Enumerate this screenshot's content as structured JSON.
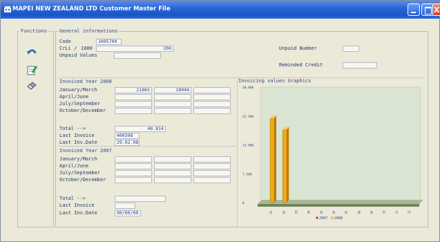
{
  "window": {
    "title": "MAPEI NEW ZEALAND LTD   Customer Master File",
    "close_glyph": "X"
  },
  "functions": {
    "legend": "Functions",
    "icons": [
      "undo-icon",
      "edit-icon",
      "eraser-icon"
    ]
  },
  "general": {
    "legend": "General informations",
    "code_label": "Code",
    "code_value": "1005700",
    "crli_label": "CrLi /",
    "crli_value1": "1000",
    "crli_value2": "200",
    "unpaid_values_label": "Unpaid Values",
    "unpaid_values_value": "",
    "unpaid_number_label": "Unpaid Number",
    "unpaid_number_value": "",
    "reminded_credit_label": "Reminded Credit",
    "reminded_credit_value": ""
  },
  "year2008": {
    "legend": "Invoiced Year 2008",
    "rows": [
      {
        "label": "January/March",
        "v1": "21865",
        "v2": "18948",
        "v3": ""
      },
      {
        "label": "April/June",
        "v1": "",
        "v2": "",
        "v3": ""
      },
      {
        "label": "July/September",
        "v1": "",
        "v2": "",
        "v3": ""
      },
      {
        "label": "October/December",
        "v1": "",
        "v2": "",
        "v3": ""
      }
    ],
    "total_label": "Total -->",
    "total_value": "40.814",
    "last_invoice_label": "Last Invoice",
    "last_invoice_value": "400398",
    "last_date_label": "Last Inv.Date",
    "last_date_value": "29.02.08"
  },
  "year2007": {
    "legend": "Invoiced Year 2007",
    "rows": [
      {
        "label": "January/March",
        "v1": "",
        "v2": "",
        "v3": ""
      },
      {
        "label": "April/June",
        "v1": "",
        "v2": "",
        "v3": ""
      },
      {
        "label": "July/September",
        "v1": "",
        "v2": "",
        "v3": ""
      },
      {
        "label": "October/December",
        "v1": "",
        "v2": "",
        "v3": ""
      }
    ],
    "total_label": "Total -->",
    "total_value": "",
    "last_invoice_label": "Last Invoice",
    "last_invoice_value": "",
    "last_date_label": "Last Inv.Date",
    "last_date_value": "00/00/00"
  },
  "chart_data": {
    "type": "bar",
    "title": "Invoicing values Graphics",
    "categories": [
      "01",
      "02",
      "03",
      "04",
      "05",
      "06",
      "07",
      "08",
      "09",
      "10",
      "11",
      "12"
    ],
    "ylim": [
      0,
      30000
    ],
    "yticks": [
      "30.000",
      "22.500",
      "15.000",
      "7.500",
      "0"
    ],
    "grid": false,
    "legend_position": "bottom",
    "series": [
      {
        "name": "2007",
        "color": "#d8202a",
        "values": [
          0,
          0,
          0,
          0,
          0,
          0,
          0,
          0,
          0,
          0,
          0,
          0
        ]
      },
      {
        "name": "2008",
        "color": "#f0a81a",
        "values": [
          21865,
          18948,
          0,
          0,
          0,
          0,
          0,
          0,
          0,
          0,
          0,
          0
        ]
      }
    ]
  }
}
